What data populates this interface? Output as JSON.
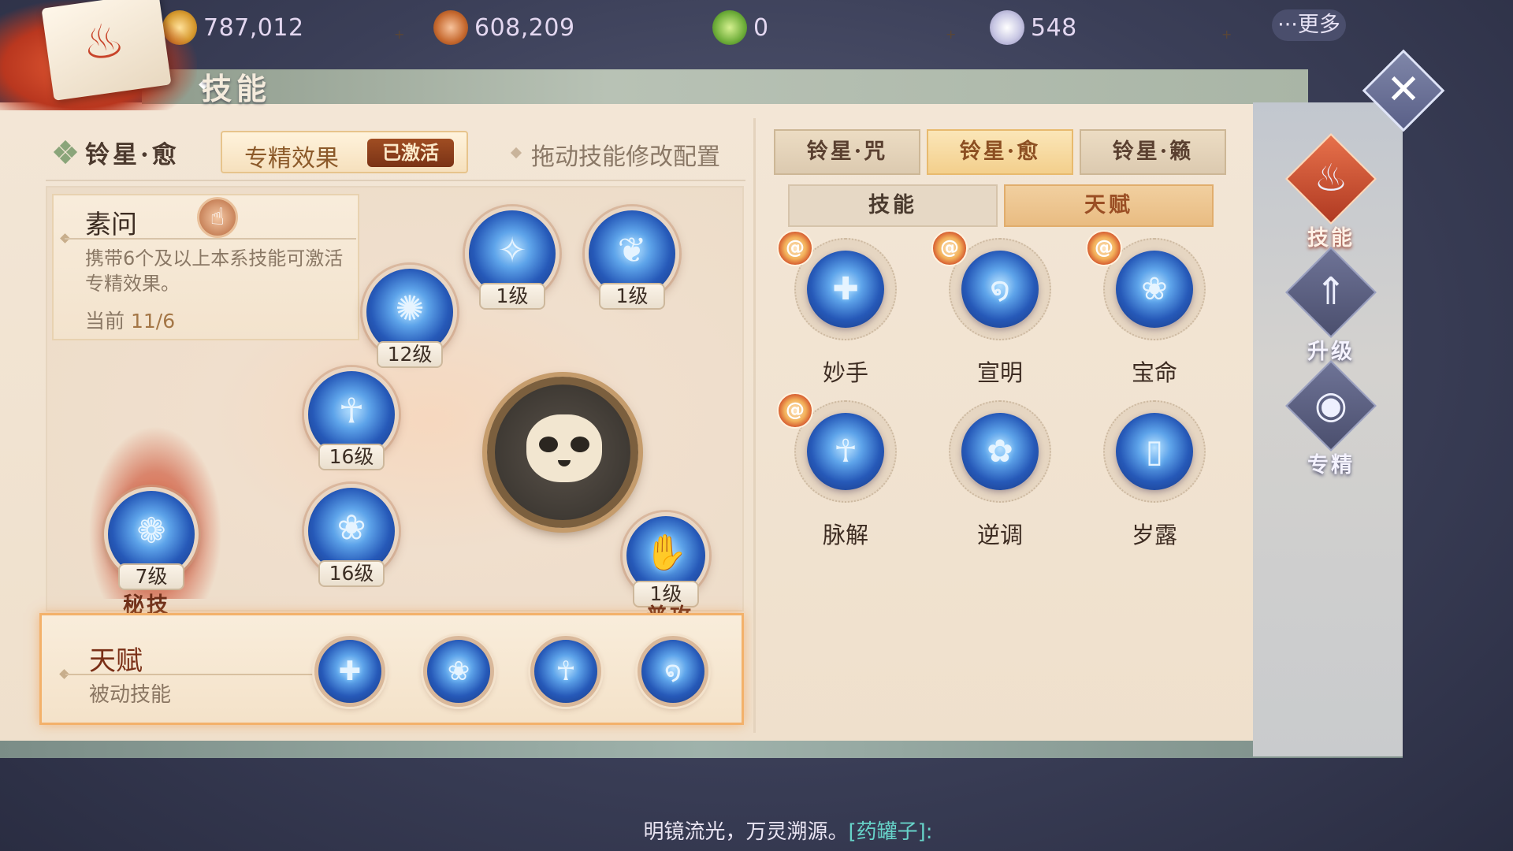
{
  "resources": [
    {
      "value": "787,012",
      "icon": "gold-coin-icon"
    },
    {
      "value": "608,209",
      "icon": "treasure-pouch-icon"
    },
    {
      "value": "0",
      "icon": "jade-gem-icon"
    },
    {
      "value": "548",
      "icon": "silver-orb-icon"
    }
  ],
  "top_more": "···更多",
  "page_title": "技能",
  "character_name": "铃星·愈",
  "spec": {
    "label": "专精效果",
    "badge": "已激活"
  },
  "drag_hint": "拖动技能修改配置",
  "suwen": {
    "title": "素问",
    "desc": "携带6个及以上本系技能可激活专精效果。",
    "current_label": "当前",
    "current_value": "11/6"
  },
  "tree_skills": [
    {
      "level": "1级"
    },
    {
      "level": "1级"
    },
    {
      "level": "12级"
    },
    {
      "level": "16级"
    },
    {
      "level": "16级"
    },
    {
      "level": "7级",
      "label": "秘技"
    },
    {
      "level": "1级",
      "label": "普攻"
    }
  ],
  "talent": {
    "title": "天赋",
    "subtitle": "被动技能"
  },
  "character_tabs": [
    "铃星·咒",
    "铃星·愈",
    "铃星·籁"
  ],
  "active_character_tab": 1,
  "sub_tabs": [
    "技能",
    "天赋"
  ],
  "active_sub_tab": 1,
  "right_skills": [
    {
      "name": "妙手",
      "equipped": true
    },
    {
      "name": "宣明",
      "equipped": true
    },
    {
      "name": "宝命",
      "equipped": true
    },
    {
      "name": "脉解",
      "equipped": true
    },
    {
      "name": "逆调",
      "equipped": false
    },
    {
      "name": "岁露",
      "equipped": false
    }
  ],
  "nav": [
    {
      "label": "技能",
      "icon": "flame-skill-icon",
      "active": true
    },
    {
      "label": "升级",
      "icon": "upgrade-arrow-icon",
      "active": false
    },
    {
      "label": "专精",
      "icon": "mastery-orb-icon",
      "active": false
    }
  ],
  "ticker": {
    "text": "明镜流光，万灵溯源。",
    "name": "[药罐子]:"
  },
  "colors": {
    "accent": "#f3b16a",
    "active_tab": "#f3cf8c",
    "skill_blue": "#2659b8"
  }
}
